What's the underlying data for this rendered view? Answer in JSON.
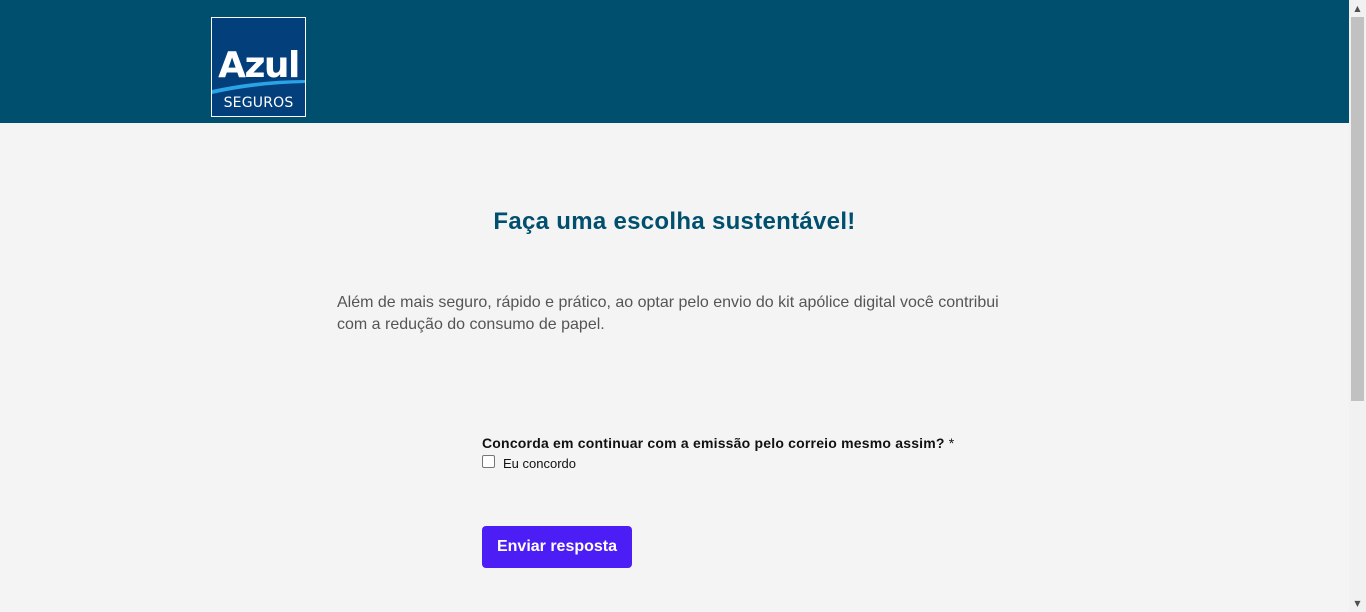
{
  "brand": {
    "logo_text": "Azul",
    "logo_subtext": "SEGUROS",
    "header_color": "#004f6e",
    "accent_color": "#4c1ef5"
  },
  "main": {
    "title": "Faça uma escolha sustentável!",
    "description": "Além de mais seguro, rápido e prático, ao optar pelo envio do kit apólice digital você contribui com a redução do consumo de papel."
  },
  "form": {
    "question": "Concorda em continuar com a emissão pelo correio mesmo assim?",
    "required_marker": "*",
    "checkbox_label": "Eu concordo",
    "checkbox_checked": false,
    "submit_label": "Enviar resposta"
  },
  "scrollbar": {
    "up_icon": "triangle-up-icon",
    "down_icon": "triangle-down-icon"
  }
}
